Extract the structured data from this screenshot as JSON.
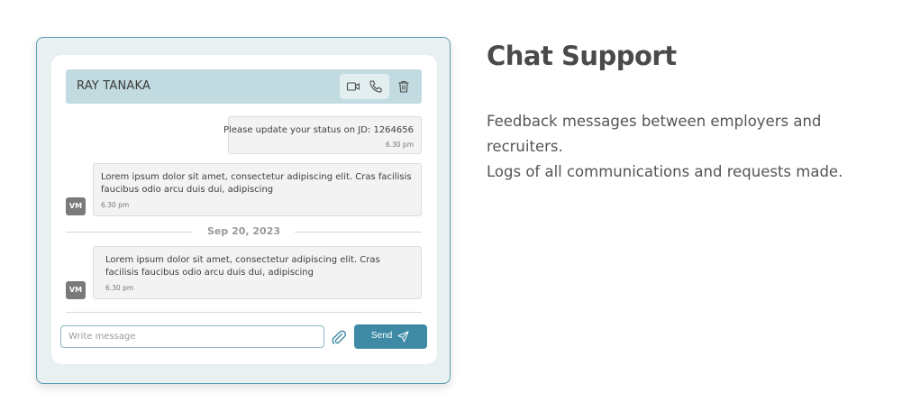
{
  "chat": {
    "contact_name": "RAY TANAKA",
    "header_icons": [
      "video-camera-icon",
      "phone-icon",
      "trash-icon"
    ],
    "messages": [
      {
        "direction": "sent",
        "text": "Please update your status on JD: 1264656",
        "time": "6.30 pm"
      },
      {
        "direction": "received",
        "avatar": "VM",
        "text": "Lorem ipsum dolor sit amet, consectetur adipiscing elit. Cras facilisis faucibus odio arcu duis dui, adipiscing",
        "time": "6.30 pm"
      },
      {
        "direction": "received",
        "avatar": "VM",
        "text": "Lorem ipsum dolor sit amet, consectetur adipiscing elit. Cras facilisis faucibus odio arcu duis dui, adipiscing",
        "time": "6.30 pm"
      }
    ],
    "date_separator": "Sep 20, 2023",
    "composer": {
      "placeholder": "Write message",
      "value": "",
      "attach_icon": "paperclip-icon",
      "send_label": "Send",
      "send_icon": "paper-plane-icon"
    }
  },
  "feature": {
    "title": "Chat Support",
    "description_lines": [
      "Feedback messages between employers and",
      "recruiters.",
      "Logs of all communications and requests made."
    ]
  },
  "colors": {
    "card_border": "#5b9db3",
    "card_background": "#e9f0f2",
    "header_background": "#c2dbe1",
    "send_button": "#3e8aa5",
    "avatar": "#7a7a7a"
  }
}
